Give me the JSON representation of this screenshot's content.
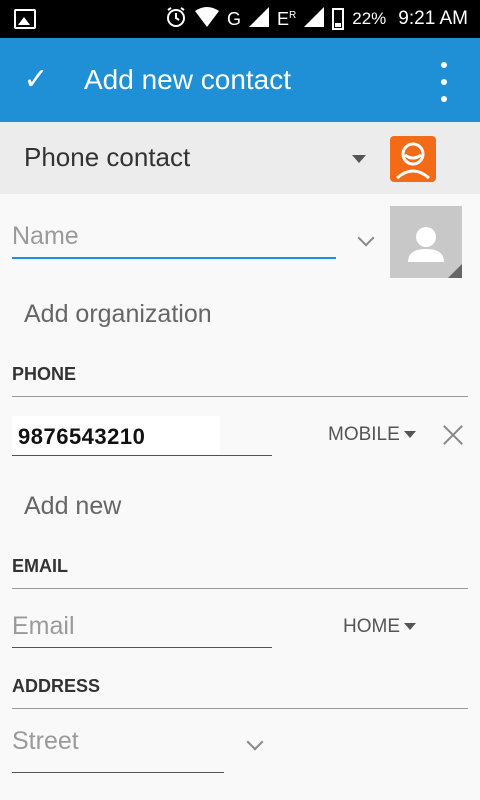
{
  "status_bar": {
    "signal_label": "G",
    "roaming_label": "E",
    "roaming_sup": "R",
    "battery_pct": "22%",
    "time": "9:21 AM"
  },
  "app_bar": {
    "title": "Add new contact",
    "bg_color": "#1f8fd6"
  },
  "account": {
    "label": "Phone contact"
  },
  "name": {
    "placeholder": "Name"
  },
  "organization": {
    "label": "Add organization"
  },
  "phone": {
    "section": "PHONE",
    "value": "9876543210",
    "type": "MOBILE",
    "add_new": "Add new"
  },
  "email": {
    "section": "EMAIL",
    "placeholder": "Email",
    "type": "HOME"
  },
  "address": {
    "section": "ADDRESS",
    "placeholder": "Street"
  }
}
